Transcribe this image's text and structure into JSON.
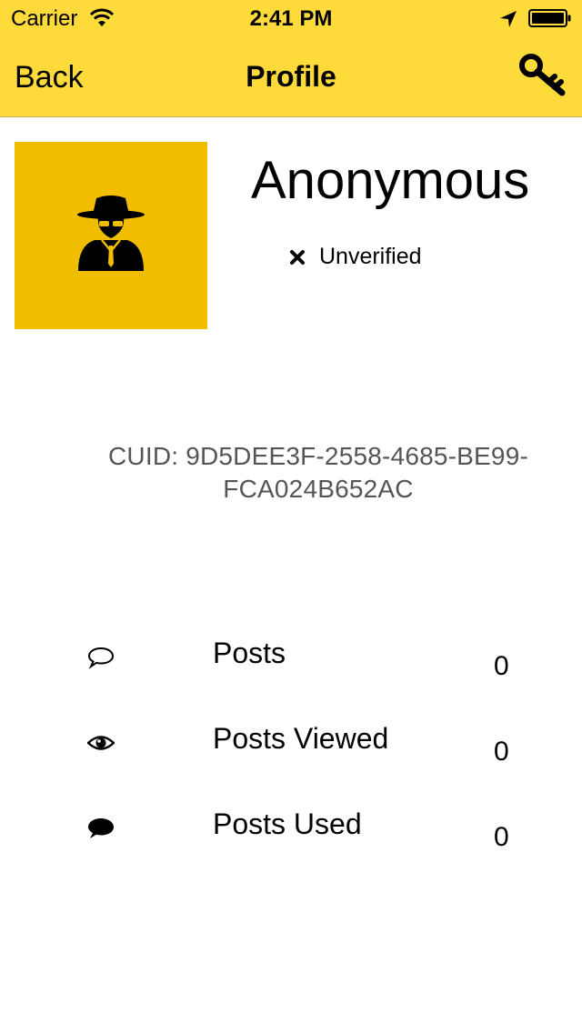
{
  "status_bar": {
    "carrier": "Carrier",
    "time": "2:41 PM"
  },
  "nav": {
    "back_label": "Back",
    "title": "Profile",
    "right_icon": "key-icon"
  },
  "profile": {
    "avatar_icon": "spy-icon",
    "name": "Anonymous",
    "verification_status": "Unverified",
    "verification_icon": "x-icon",
    "cuid": "CUID: 9D5DEE3F-2558-4685-BE99-FCA024B652AC"
  },
  "stats": [
    {
      "icon": "speech-bubble-outline-icon",
      "label": "Posts",
      "value": "0"
    },
    {
      "icon": "eye-icon",
      "label": "Posts Viewed",
      "value": "0"
    },
    {
      "icon": "speech-bubble-filled-icon",
      "label": "Posts Used",
      "value": "0"
    }
  ],
  "colors": {
    "bar_background": "#FEDA3A",
    "avatar_background": "#F1BD00",
    "cuid_text": "#555555"
  }
}
